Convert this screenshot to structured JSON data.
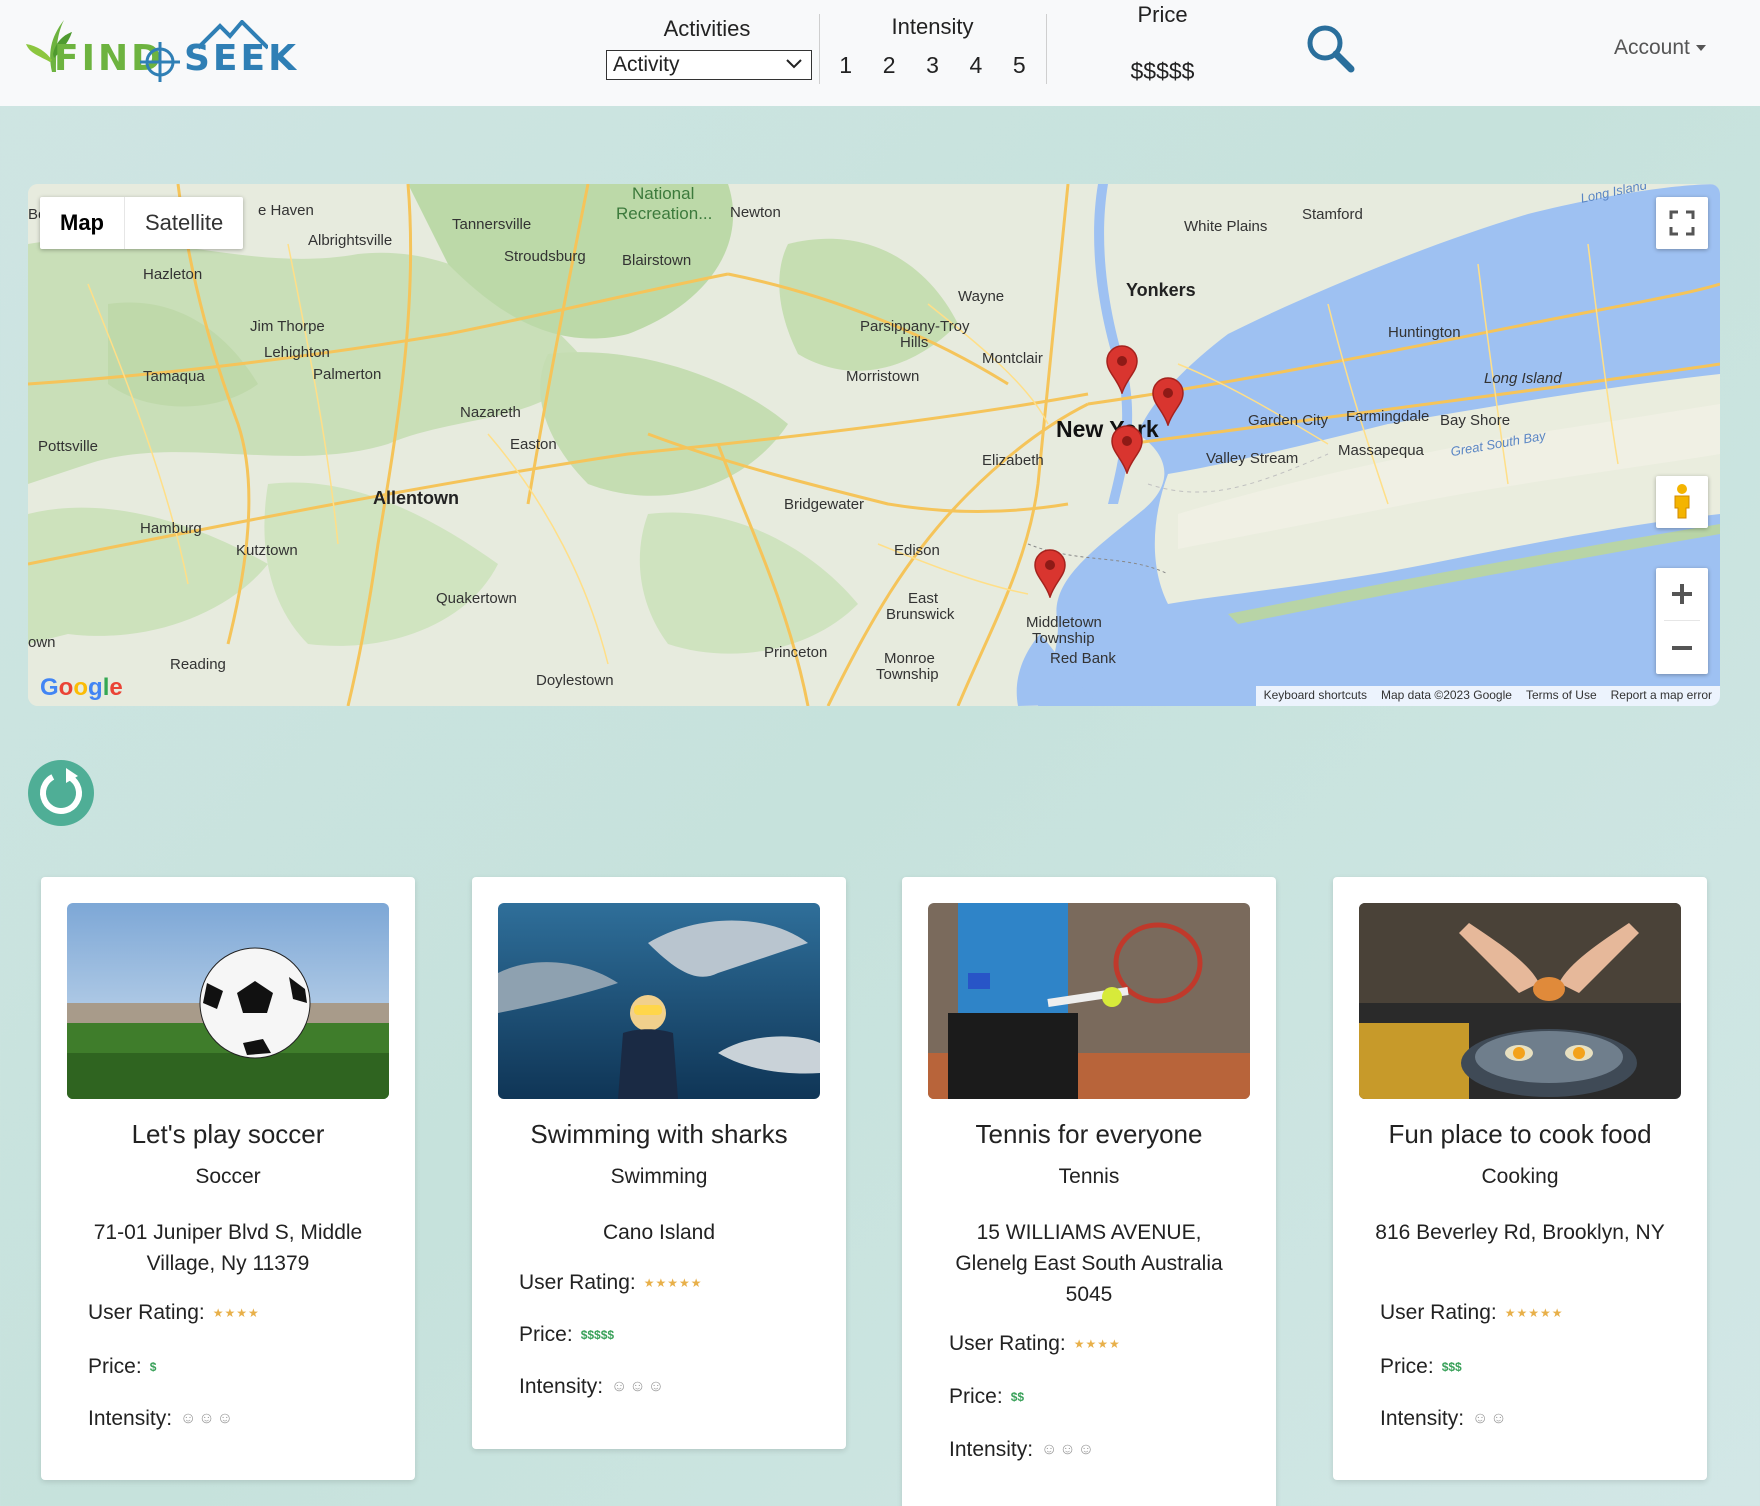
{
  "brand": {
    "logo_word_1": "FIND",
    "logo_word_2": "SEEK"
  },
  "filters": {
    "activities_label": "Activities",
    "activity_select_value": "Activity",
    "intensity_label": "Intensity",
    "intensity_levels": [
      "1",
      "2",
      "3",
      "4",
      "5"
    ],
    "price_label": "Price",
    "price_value": "$$$$$"
  },
  "account_label": "Account",
  "map": {
    "type_map": "Map",
    "type_satellite": "Satellite",
    "google": "Google",
    "attribution": [
      "Keyboard shortcuts",
      "Map data ©2023 Google",
      "Terms of Use",
      "Report a map error"
    ],
    "places": {
      "new_york": "New York",
      "yonkers": "Yonkers",
      "allentown": "Allentown",
      "white_plains": "White Plains",
      "stamford": "Stamford",
      "huntington": "Huntington",
      "long_island": "Long Island",
      "garden_city": "Garden City",
      "farmingdale": "Farmingdale",
      "bay_shore": "Bay Shore",
      "massapequa": "Massapequa",
      "valley_stream": "Valley Stream",
      "great_south_bay": "Great South Bay",
      "long_island_sound": "Long Island",
      "elizabeth": "Elizabeth",
      "montclair": "Montclair",
      "wayne": "Wayne",
      "parsippany": "Parsippany-Troy",
      "parsippany2": "Hills",
      "morristown": "Morristown",
      "bridgewater": "Bridgewater",
      "edison": "Edison",
      "east_brunswick": "East",
      "east_brunswick2": "Brunswick",
      "middletown": "Middletown",
      "middletown2": "Township",
      "red_bank": "Red Bank",
      "princeton": "Princeton",
      "monroe": "Monroe",
      "monroe2": "Township",
      "doylestown": "Doylestown",
      "quakertown": "Quakertown",
      "reading": "Reading",
      "kutztown": "Kutztown",
      "hamburg": "Hamburg",
      "pottsville": "Pottsville",
      "tamaqua": "Tamaqua",
      "hazleton": "Hazleton",
      "jim_thorpe": "Jim Thorpe",
      "lehighton": "Lehighton",
      "palmerton": "Palmerton",
      "nazareth": "Nazareth",
      "easton": "Easton",
      "stroudsburg": "Stroudsburg",
      "tannersville": "Tannersville",
      "albrightsville": "Albrightsville",
      "blairstown": "Blairstown",
      "newton": "Newton",
      "national": "National",
      "recreation": "Recreation...",
      "haven": "e Haven",
      "own": "own",
      "be": "Be"
    }
  },
  "cards": [
    {
      "title": "Let's play soccer",
      "category": "Soccer",
      "address": "71-01 Juniper Blvd S, Middle Village, Ny 11379",
      "rating_label": "User Rating:",
      "rating": "★★★★",
      "price_label": "Price:",
      "price": "$",
      "intensity_label": "Intensity:",
      "intensity": "☺☺☺"
    },
    {
      "title": "Swimming with sharks",
      "category": "Swimming",
      "address": "Cano Island",
      "rating_label": "User Rating:",
      "rating": "★★★★★",
      "price_label": "Price:",
      "price": "$$$$$",
      "intensity_label": "Intensity:",
      "intensity": "☺☺☺"
    },
    {
      "title": "Tennis for everyone",
      "category": "Tennis",
      "address": "15 WILLIAMS AVENUE, Glenelg East South Australia 5045",
      "rating_label": "User Rating:",
      "rating": "★★★★",
      "price_label": "Price:",
      "price": "$$",
      "intensity_label": "Intensity:",
      "intensity": "☺☺☺"
    },
    {
      "title": "Fun place to cook food",
      "category": "Cooking",
      "address": "816 Beverley Rd, Brooklyn, NY",
      "rating_label": "User Rating:",
      "rating": "★★★★★",
      "price_label": "Price:",
      "price": "$$$",
      "intensity_label": "Intensity:",
      "intensity": "☺☺"
    }
  ],
  "icons": {
    "search": "search-icon",
    "refresh": "refresh-icon",
    "fullscreen": "fullscreen-icon",
    "pegman": "pegman-icon",
    "zoom_in": "plus-icon",
    "zoom_out": "minus-icon",
    "pin": "map-pin-icon"
  },
  "colors": {
    "accent_teal": "#4fae96",
    "search_blue": "#2a6f9c",
    "pin_red": "#d9352f",
    "water": "#9ec1f2"
  }
}
